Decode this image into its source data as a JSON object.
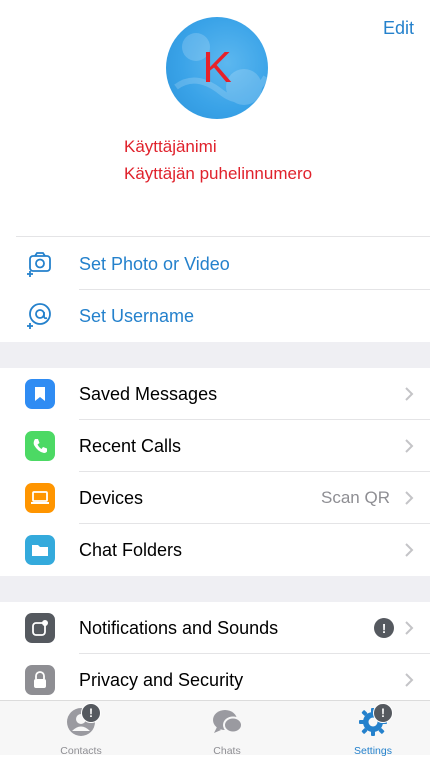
{
  "header": {
    "edit_label": "Edit",
    "avatar_letter": "K",
    "username": "Käyttäjänimi",
    "phone": "Käyttäjän puhelinnumero"
  },
  "profile_actions": [
    {
      "label": "Set Photo or Video",
      "icon": "camera-add-icon"
    },
    {
      "label": "Set Username",
      "icon": "at-sign-icon"
    }
  ],
  "menu_group_1": [
    {
      "label": "Saved Messages",
      "icon": "bookmark-icon",
      "color": "#2f8cf3"
    },
    {
      "label": "Recent Calls",
      "icon": "phone-icon",
      "color": "#4cd964"
    },
    {
      "label": "Devices",
      "icon": "laptop-icon",
      "color": "#ff9500",
      "value": "Scan QR"
    },
    {
      "label": "Chat Folders",
      "icon": "folder-icon",
      "color": "#34aadc"
    }
  ],
  "menu_group_2": [
    {
      "label": "Notifications and Sounds",
      "icon": "notification-icon",
      "color": "#55595f",
      "alert": "!"
    },
    {
      "label": "Privacy and Security",
      "icon": "lock-icon",
      "color": "#8e8e93"
    }
  ],
  "tabbar": {
    "tabs": [
      {
        "label": "Contacts",
        "icon": "person-icon",
        "badge": "!"
      },
      {
        "label": "Chats",
        "icon": "chat-bubbles-icon"
      },
      {
        "label": "Settings",
        "icon": "gear-icon",
        "badge": "!",
        "active": true
      }
    ]
  },
  "colors": {
    "accent": "#2481cc",
    "annotation_red": "#e0222c"
  }
}
